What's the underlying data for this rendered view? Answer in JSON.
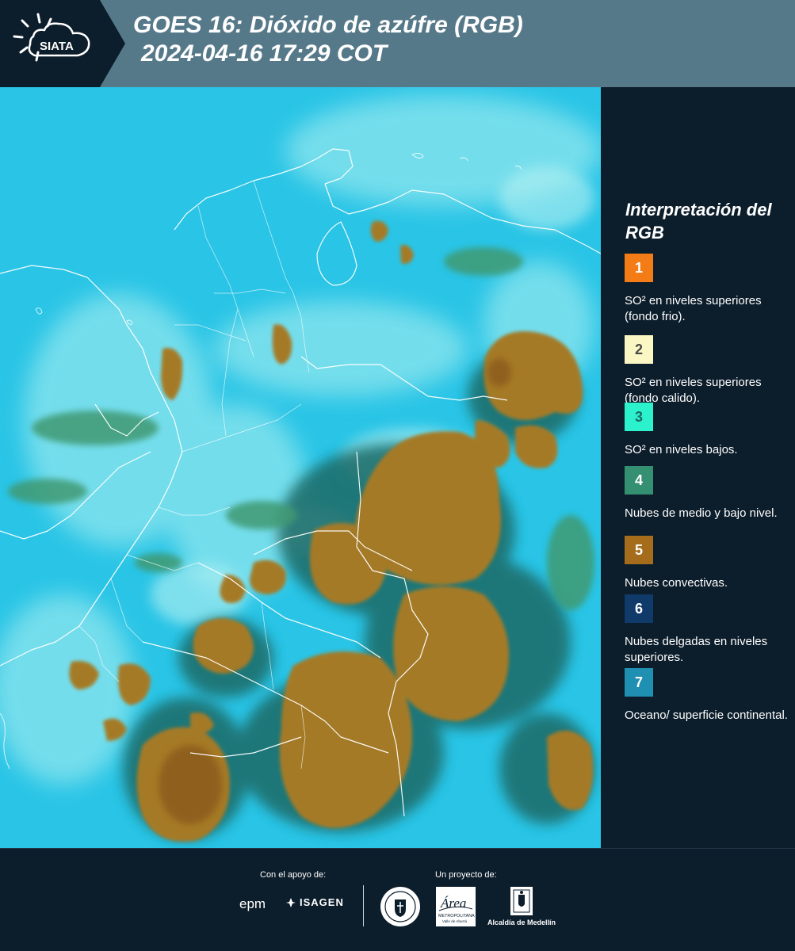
{
  "header": {
    "title_line_1": "GOES 16: Dióxido de azúfre (RGB)",
    "title_line_2": "2024-04-16 17:29 COT",
    "logo_text": "SIATA",
    "background_color": "#56798a",
    "logo_panel_color": "#0c1d2b"
  },
  "map": {
    "ocean_color": "#29c4e6",
    "haze_color": "#8ee6ee",
    "convective_color": "#a57a26",
    "green_cloud_color": "#3f9a72",
    "dark_cloud_color": "#1f6a66",
    "border_color": "#ffffff"
  },
  "legend": {
    "title": "Interpretación del RGB",
    "items": [
      {
        "number": "1",
        "color": "#f47c16",
        "text_color": "#ffffff",
        "label": "SO² en niveles superiores (fondo frio)."
      },
      {
        "number": "2",
        "color": "#fbf7c5",
        "text_color": "#4a4a4a",
        "label": "SO² en niveles superiores (fondo calido)."
      },
      {
        "number": "3",
        "color": "#2cf1cd",
        "text_color": "#1c6a61",
        "label": "SO² en niveles bajos."
      },
      {
        "number": "4",
        "color": "#349071",
        "text_color": "#ffffff",
        "label": "Nubes de medio y bajo nivel."
      },
      {
        "number": "5",
        "color": "#a56d1b",
        "text_color": "#ffffff",
        "label": "Nubes convectivas."
      },
      {
        "number": "6",
        "color": "#0f3a69",
        "text_color": "#ffffff",
        "label": "Nubes delgadas en niveles superiores."
      },
      {
        "number": "7",
        "color": "#1f8fb2",
        "text_color": "#ffffff",
        "label": "Oceano/ superficie continental."
      }
    ]
  },
  "footer": {
    "support_label": "Con el apoyo de:",
    "project_label": "Un proyecto de:",
    "epm_text": "epm",
    "isagen_text": "ISAGEN",
    "area_text": "Área",
    "area_subtext": "METROPOLITANA",
    "area_subtext_2": "Valle de Aburrá",
    "alcaldia_text": "Alcaldía de Medellín"
  }
}
